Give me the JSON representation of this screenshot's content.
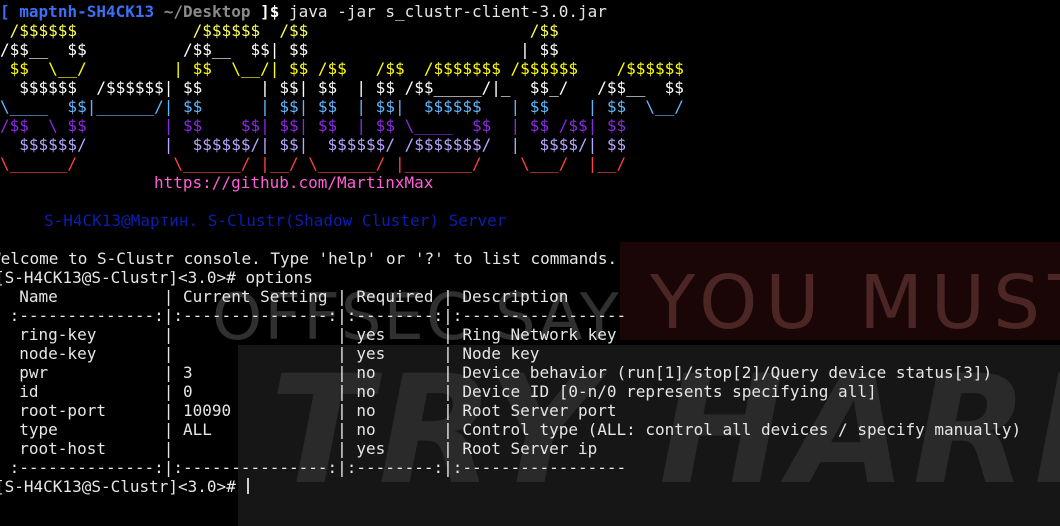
{
  "wallpaper": {
    "text_top": "OFFSEC SAY",
    "text_mid": "YOU MUST",
    "text_big": "TRY HARDER"
  },
  "prompt": {
    "open_bracket": "[",
    "user_host": "maptnh-SH4CK13",
    "path": "~/Desktop",
    "close": "]$",
    "command": "java -jar s_clustr-client-3.0.jar"
  },
  "banner_lines": [
    {
      "text": " /$$$$$$            /$$$$$$  /$$                       /$$",
      "color": "#ffff54"
    },
    {
      "text": "/$$__  $$          /$$__  $$| $$                      | $$",
      "color": "#ffffff"
    },
    {
      "text": " $$  \\__/         | $$  \\__/| $$ /$$   /$$  /$$$$$$$ /$$$$$$    /$$$$$$",
      "color": "#ffff00"
    },
    {
      "text": "  $$$$$$  /$$$$$$| $$      | $$| $$  | $$ /$$_____/|_  $$_/   /$$__  $$",
      "color": "#ffffff"
    },
    {
      "text": "\\____  $$|______/| $$      | $$| $$  | $$|  $$$$$$   | $$    | $$  \\__/",
      "color": "#5fb7ff"
    },
    {
      "text": "/$$  \\ $$        | $$    $$| $$| $$  | $$ \\____  $$  | $$ /$$| $$",
      "color": "#8a2be2"
    },
    {
      "text": "  $$$$$$/        |  $$$$$$/| $$|  $$$$$$/ /$$$$$$$/  |  $$$$/| $$",
      "color": "#b9a6ff"
    },
    {
      "text": "\\______/          \\______/ |__/ \\______/ |_______/    \\___/  |__/",
      "color": "#ff4040"
    }
  ],
  "url": "https://github.com/MartinxMax",
  "server_line": "S-H4CK13@Мартин. S-Clustr(Shadow Cluster) Server",
  "welcome": "Welcome to S-Clustr console. Type 'help' or '?' to list commands.",
  "console_prompt": "[S-H4CK13@S-Clustr]<3.0>#",
  "console_command": "options",
  "options_table": {
    "headers": [
      "Name",
      "Current Setting",
      "Required",
      "Description"
    ],
    "separator": " :--------------:|:---------------:|:--------:|:-----------------",
    "rows": [
      [
        "ring-key",
        "",
        "yes",
        "Ring Network key"
      ],
      [
        "node-key",
        "",
        "yes",
        "Node key"
      ],
      [
        "pwr",
        "3",
        "no",
        "Device behavior (run[1]/stop[2]/Query device status[3])"
      ],
      [
        "id",
        "0",
        "no",
        "Device ID [0-n/0 represents specifying all]"
      ],
      [
        "root-port",
        "10090",
        "no",
        "Root Server port"
      ],
      [
        "type",
        "ALL",
        "no",
        "Control type (ALL: control all devices / specify manually)"
      ],
      [
        "root-host",
        "",
        "yes",
        "Root Server ip"
      ]
    ]
  },
  "colors": {
    "background": "#000000",
    "prompt_blue": "#3b6ff5",
    "url_pink": "#ff5fd7",
    "server_blue": "#0a1fb0"
  }
}
